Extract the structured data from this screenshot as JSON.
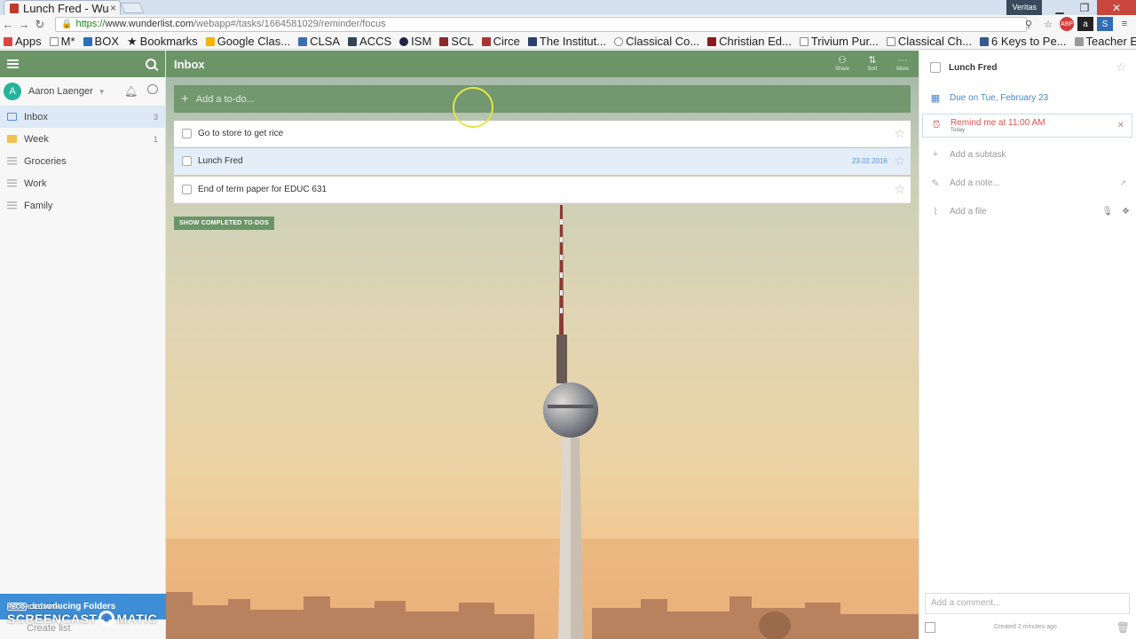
{
  "browser": {
    "tab_title": "Lunch Fred - Wu",
    "tab_close": "×",
    "profile": "Veritas",
    "url_scheme": "https://",
    "url_host": "www.wunderlist.com",
    "url_path": "/webapp#/tasks/1664581029/reminder/focus",
    "bookmarks": [
      "Apps",
      "M*",
      "BOX",
      "Bookmarks",
      "Google Clas...",
      "CLSA",
      "ACCS",
      "ISM",
      "SCL",
      "Circe",
      "The Institut...",
      "Classical Co...",
      "Christian Ed...",
      "Trivium Pur...",
      "Classical Ch...",
      "6 Keys to Pe...",
      "Teacher Eva..."
    ]
  },
  "sidebar": {
    "user_name": "Aaron Laenger",
    "avatar_initial": "A",
    "lists": [
      {
        "label": "Inbox",
        "count": "3"
      },
      {
        "label": "Week",
        "count": "1"
      },
      {
        "label": "Groceries",
        "count": ""
      },
      {
        "label": "Work",
        "count": ""
      },
      {
        "label": "Family",
        "count": ""
      }
    ],
    "new_tag": "NEW",
    "folders_banner": "Introducing Folders",
    "create_list": "Create list"
  },
  "main": {
    "title": "Inbox",
    "actions": {
      "share": "Share",
      "sort": "Sort",
      "more": "More"
    },
    "add_placeholder": "Add a to-do...",
    "tasks": [
      {
        "title": "Go to store to get rice",
        "date": ""
      },
      {
        "title": "Lunch Fred",
        "date": "23.02.2016"
      },
      {
        "title": "End of term paper for EDUC 631",
        "date": ""
      }
    ],
    "show_completed": "SHOW COMPLETED TO-DOS"
  },
  "detail": {
    "title": "Lunch Fred",
    "due": "Due on Tue, February 23",
    "remind": "Remind me at 11:00 AM",
    "remind_sub": "Today",
    "add_subtask": "Add a subtask",
    "add_note": "Add a note...",
    "add_file": "Add a file",
    "comment_placeholder": "Add a comment...",
    "created": "Created 2 minutes ago"
  },
  "watermark": {
    "line1": "RECORDED WITH",
    "brand_left": "SCREENCAST",
    "brand_right": "MATIC"
  },
  "colors": {
    "header_green": "#6b9467",
    "accent_blue": "#4b86c9",
    "reminder_red": "#d9534f",
    "avatar_teal": "#27b39b"
  }
}
